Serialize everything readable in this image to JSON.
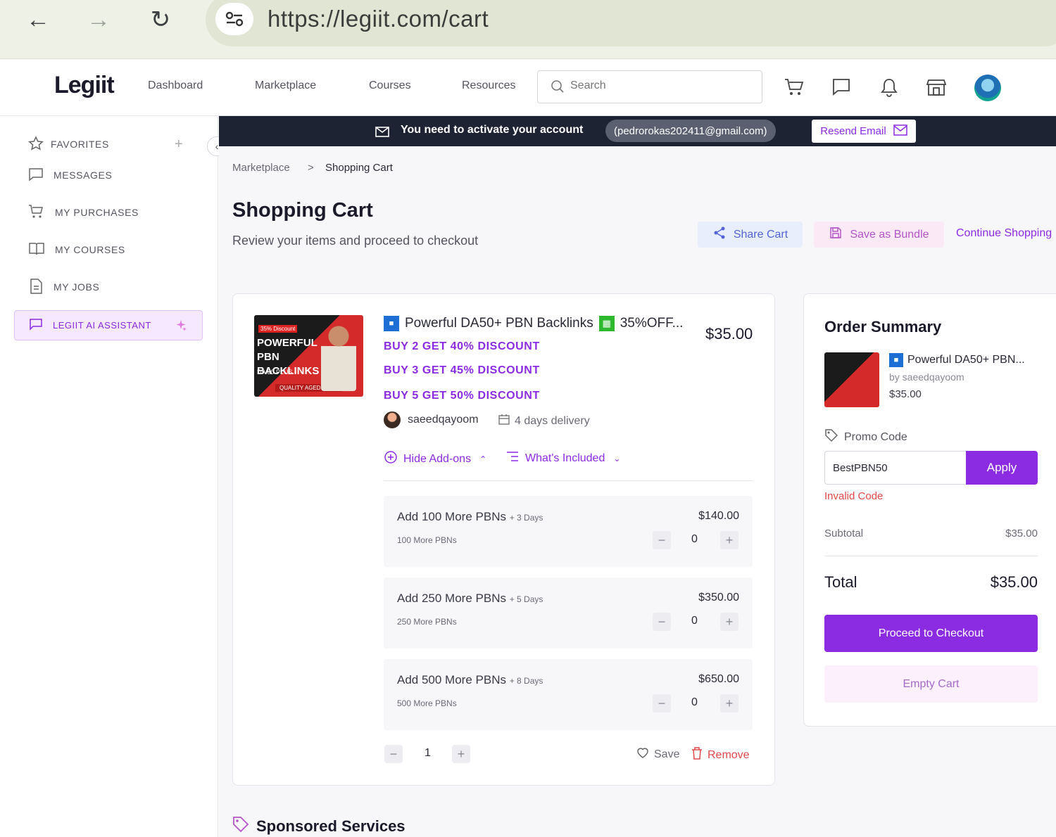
{
  "browser": {
    "url": "https://legiit.com/cart"
  },
  "nav": {
    "logo": "Legiit",
    "links": [
      "Dashboard",
      "Marketplace",
      "Courses",
      "Resources"
    ],
    "search_placeholder": "Search"
  },
  "sidebar": {
    "items": [
      {
        "label": "FAVORITES",
        "icon": "star-icon"
      },
      {
        "label": "MESSAGES",
        "icon": "message-icon"
      },
      {
        "label": "MY PURCHASES",
        "icon": "cart-icon"
      },
      {
        "label": "MY COURSES",
        "icon": "book-icon"
      },
      {
        "label": "MY JOBS",
        "icon": "document-icon"
      }
    ],
    "ai_assistant": "LEGIIT AI ASSISTANT"
  },
  "banner": {
    "message": "You need to activate your account",
    "email": "(pedrorokas202411@gmail.com)",
    "resend": "Resend Email"
  },
  "breadcrumb": {
    "parent": "Marketplace",
    "sep": ">",
    "current": "Shopping Cart"
  },
  "page": {
    "title": "Shopping Cart",
    "subtitle": "Review your items and proceed to checkout",
    "share": "Share Cart",
    "bundle": "Save as Bundle",
    "continue": "Continue Shopping"
  },
  "cart_item": {
    "thumb": {
      "tag": "35% Discount",
      "headline": "POWERFUL PBN BACKLINKS",
      "sub": "DA 50 PLUS",
      "footer": "QUALITY AGED PBNS"
    },
    "title": "Powerful DA50+ PBN Backlinks",
    "title_suffix": "35%OFF...",
    "price": "$35.00",
    "offers": [
      "BUY 2 GET 40% DISCOUNT",
      "BUY 3 GET 45% DISCOUNT",
      "BUY 5 GET 50% DISCOUNT"
    ],
    "seller": "saeedqayoom",
    "delivery": "4 days delivery",
    "hide_addons": "Hide Add-ons",
    "whats_included": "What's Included",
    "addons": [
      {
        "title": "Add 100 More PBNs",
        "days": "+ 3 Days",
        "sub": "100 More PBNs",
        "price": "$140.00",
        "qty": "0"
      },
      {
        "title": "Add 250 More PBNs",
        "days": "+ 5 Days",
        "sub": "250 More PBNs",
        "price": "$350.00",
        "qty": "0"
      },
      {
        "title": "Add 500 More PBNs",
        "days": "+ 8 Days",
        "sub": "500 More PBNs",
        "price": "$650.00",
        "qty": "0"
      }
    ],
    "quantity": "1",
    "save": "Save",
    "remove": "Remove"
  },
  "summary": {
    "title": "Order Summary",
    "item_name": "Powerful DA50+ PBN...",
    "item_by": "by saeedqayoom",
    "item_price": "$35.00",
    "promo_label": "Promo Code",
    "promo_value": "BestPBN50",
    "apply": "Apply",
    "invalid": "Invalid Code",
    "subtotal_label": "Subtotal",
    "subtotal": "$35.00",
    "total_label": "Total",
    "total": "$35.00",
    "checkout": "Proceed to Checkout",
    "empty": "Empty Cart"
  },
  "sponsored": "Sponsored Services",
  "colors": {
    "accent": "#8b2be2",
    "error": "#e0484b",
    "banner": "#1d2333"
  }
}
